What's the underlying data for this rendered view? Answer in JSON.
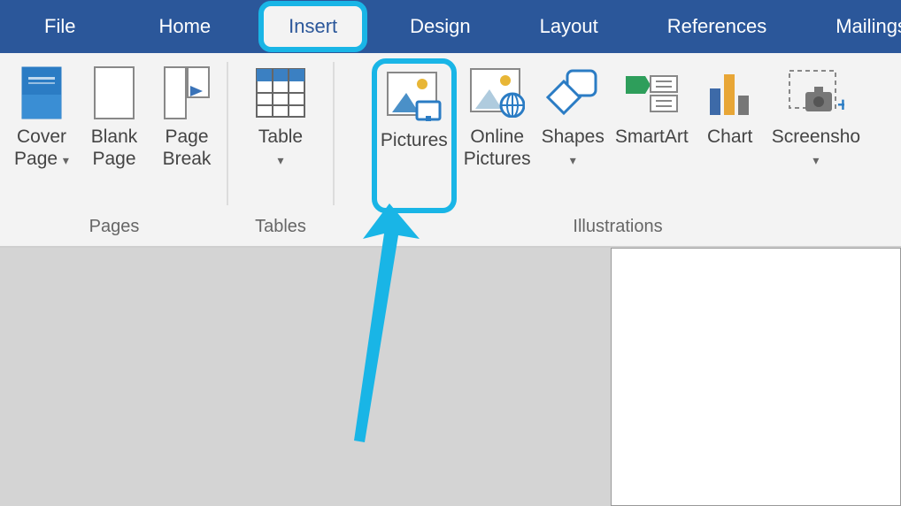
{
  "tabs": {
    "file": "File",
    "home": "Home",
    "insert": "Insert",
    "design": "Design",
    "layout": "Layout",
    "references": "References",
    "mailings": "Mailings"
  },
  "pages": {
    "cover_page": "Cover\nPage",
    "blank_page": "Blank\nPage",
    "page_break": "Page\nBreak",
    "group_label": "Pages"
  },
  "tables": {
    "table": "Table",
    "group_label": "Tables"
  },
  "illustrations": {
    "pictures": "Pictures",
    "online_pictures": "Online\nPictures",
    "shapes": "Shapes",
    "smartart": "SmartArt",
    "chart": "Chart",
    "screenshot": "Screensho",
    "group_label": "Illustrations"
  }
}
